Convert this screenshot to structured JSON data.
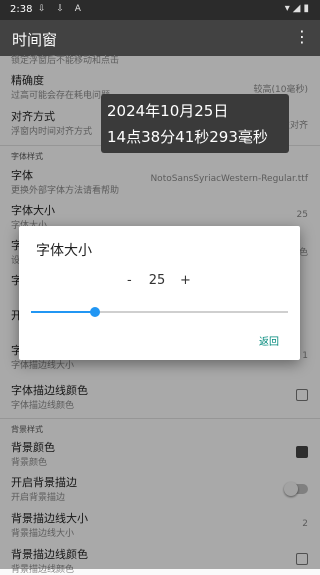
{
  "status_bar": {
    "time": "2:38",
    "left_icons": "⇩ ⇩ A",
    "right_icons": "▾◢▮"
  },
  "app_bar": {
    "title": "时间窗",
    "menu_icon": "more-vert-icon"
  },
  "settings": {
    "clipped_top": "锁定浮窗后不能移动和点击",
    "precision": {
      "title": "精确度",
      "subtitle": "过高可能会存在耗电问题",
      "value": "较高(10毫秒)"
    },
    "alignment": {
      "title": "对齐方式",
      "subtitle": "浮窗内时间对齐方式",
      "value": "居左对齐"
    },
    "font_section": "字体样式",
    "font": {
      "title": "字体",
      "subtitle": "更换外部字体方法请看帮助",
      "value": "NotoSansSyriacWestern-Regular.ttf"
    },
    "font_size": {
      "title": "字体大小",
      "subtitle": "字体大小",
      "value": "25"
    },
    "hidden_row_1": {
      "title": "字",
      "subtitle": "设",
      "value": "色"
    },
    "hidden_row_2": {
      "title": "字"
    },
    "hidden_row_3": {
      "title": "开"
    },
    "stroke_width": {
      "title": "字",
      "subtitle": "字体描边线大小",
      "value": "1"
    },
    "stroke_color": {
      "title": "字体描边线颜色",
      "subtitle": "字体描边线颜色"
    },
    "bg_section": "背景样式",
    "bg_color": {
      "title": "背景颜色",
      "subtitle": "背景颜色"
    },
    "bg_stroke": {
      "title": "开启背景描边",
      "subtitle": "开启背景描边"
    },
    "bg_stroke_width": {
      "title": "背景描边线大小",
      "subtitle": "背景描边线大小",
      "value": "2"
    },
    "bg_stroke_color": {
      "title": "背景描边线颜色",
      "subtitle": "背景描边线颜色"
    }
  },
  "floating_window": {
    "line1": "2024年10月25日",
    "line2": "14点38分41秒293毫秒"
  },
  "dialog": {
    "title": "字体大小",
    "minus": "-",
    "value": "25",
    "plus": "+",
    "slider_fraction": 0.25,
    "back_label": "返回"
  },
  "colors": {
    "accent": "#2196f3",
    "dialog_button": "#00897b",
    "app_bar": "#424242"
  }
}
